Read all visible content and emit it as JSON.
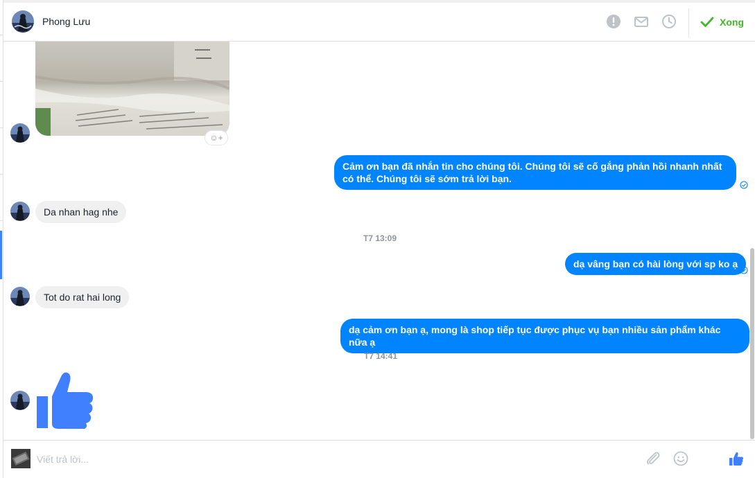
{
  "header": {
    "contact_name": "Phong Lưu",
    "done_label": "Xong",
    "icons": [
      "alert-icon",
      "mail-icon",
      "clock-icon",
      "checkmark-icon"
    ]
  },
  "messages": {
    "out_1": "Cảm ơn bạn đã nhắn tin cho chúng tôi. Chúng tôi sẽ cố gắng phản hồi nhanh nhất có thể. Chúng tôi sẽ sớm trả lời bạn.",
    "in_1": "Da nhan hag nhe",
    "time_1": "T7 13:09",
    "out_2": "dạ vâng bạn có hài lòng với sp ko ạ",
    "in_2": "Tot do rat hai long",
    "out_3": "dạ cảm ơn bạn ạ, mong là shop tiếp tục được phục vụ bạn nhiều sản phẩm khác nữa ạ",
    "time_2": "T7 14:41"
  },
  "composer": {
    "placeholder": "Viết trả lời...",
    "icons": [
      "attachment-icon",
      "emoji-icon",
      "like-icon"
    ]
  },
  "colors": {
    "accent": "#0084ff",
    "done": "#42b72a",
    "incoming_bubble": "#f1f0f0",
    "like": "#4080ff"
  }
}
